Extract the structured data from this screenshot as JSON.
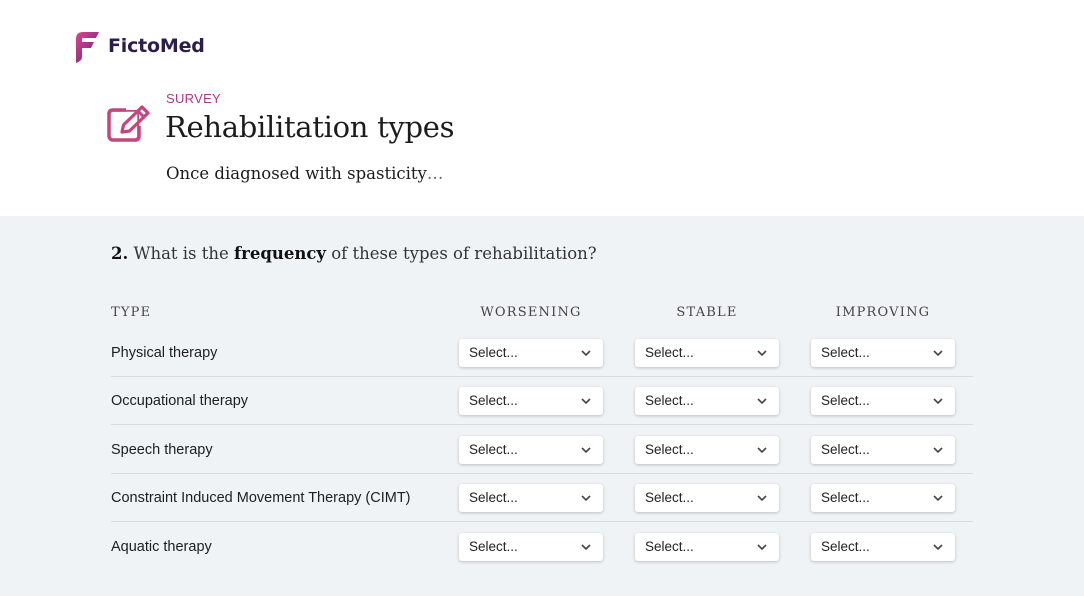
{
  "brand": {
    "name": "FictoMed",
    "icon": "fictomed-logo-icon",
    "colors": {
      "pink": "#d13f8a",
      "purple": "#5b2a86",
      "dark": "#2b1e4a"
    }
  },
  "header": {
    "eyebrow": "SURVEY",
    "title": "Rehabilitation types",
    "subtitle": "Once diagnosed with spasticity",
    "subtitle_ellipsis": "…",
    "icon": "edit-icon",
    "accent": "#b0387f"
  },
  "question": {
    "number": "2.",
    "prefix": "What is the",
    "emphasis": "frequency",
    "suffix": "of these types of rehabilitation?"
  },
  "table": {
    "columns": [
      "TYPE",
      "WORSENING",
      "STABLE",
      "IMPROVING"
    ],
    "rows": [
      {
        "label": "Physical therapy",
        "selects": [
          "Select...",
          "Select...",
          "Select..."
        ]
      },
      {
        "label": "Occupational therapy",
        "selects": [
          "Select...",
          "Select...",
          "Select..."
        ]
      },
      {
        "label": "Speech therapy",
        "selects": [
          "Select...",
          "Select...",
          "Select..."
        ]
      },
      {
        "label": "Constraint Induced Movement Therapy (CIMT)",
        "selects": [
          "Select...",
          "Select...",
          "Select..."
        ]
      },
      {
        "label": "Aquatic therapy",
        "selects": [
          "Select...",
          "Select...",
          "Select..."
        ]
      }
    ]
  }
}
